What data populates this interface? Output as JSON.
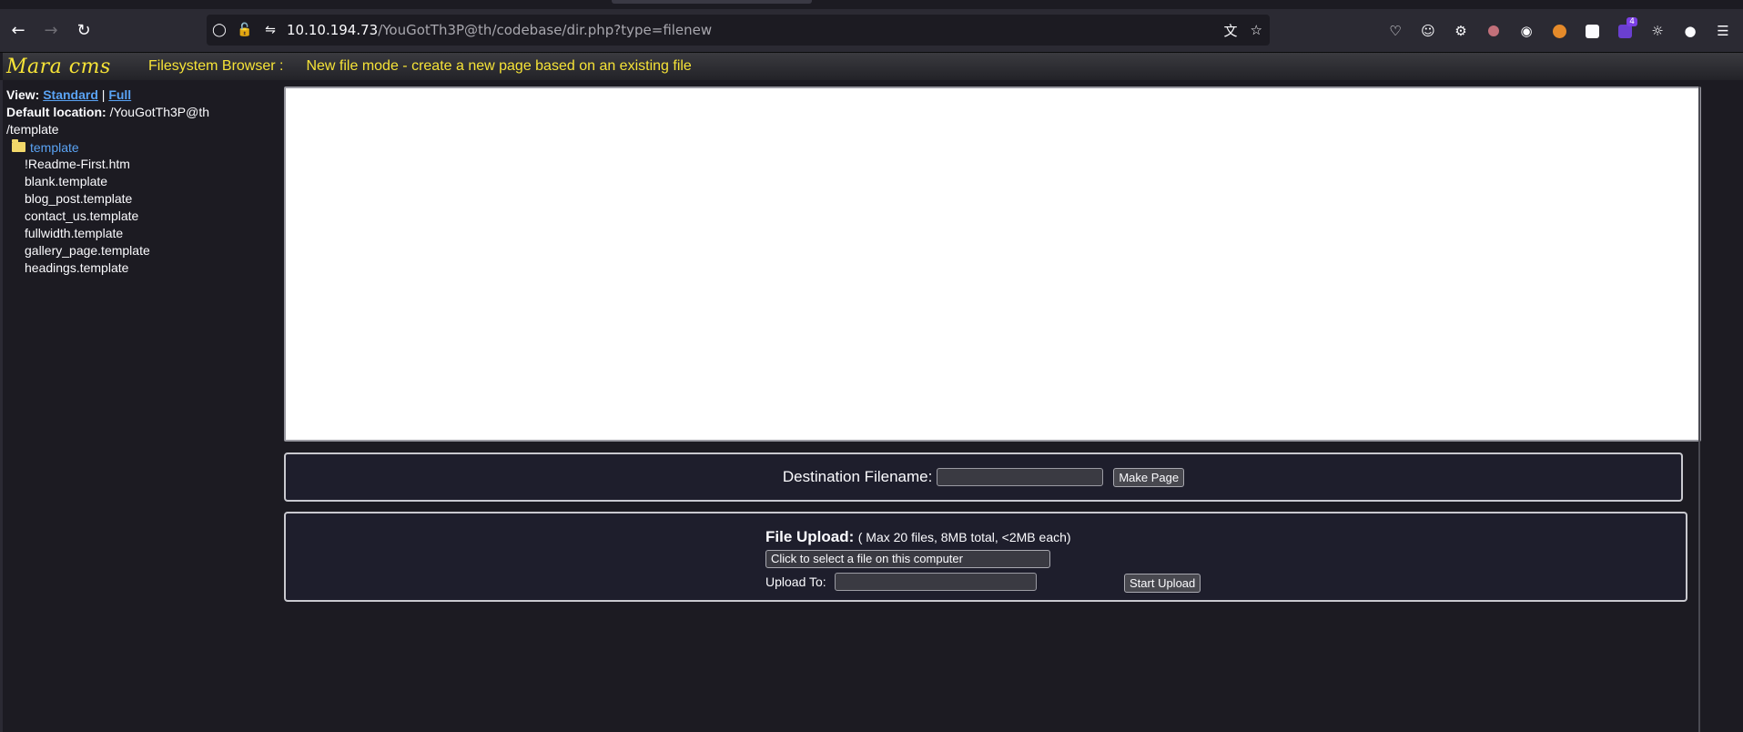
{
  "browser": {
    "url_host": "10.10.194.73",
    "url_path": "/YouGotTh3P@th/codebase/dir.php?type=filenew",
    "extension_badge": "4",
    "icons": [
      "back-icon",
      "forward-icon",
      "reload-icon",
      "shield-icon",
      "lock-icon",
      "permissions-icon",
      "translate-icon",
      "bookmark-star-icon",
      "pocket-icon",
      "account-icon",
      "extensions-icon",
      "ext-1-icon",
      "ext-2-icon",
      "ext-3-icon",
      "ext-4-icon",
      "ext-5-icon",
      "ext-6-icon",
      "ext-7-icon",
      "menu-icon"
    ]
  },
  "cms": {
    "logo": "Mara cms",
    "title": "Filesystem Browser :",
    "mode": "New file mode - create a new page based on an existing file"
  },
  "sidebar": {
    "view_label": "View:",
    "view_standard": "Standard",
    "view_separator": "|",
    "view_full": "Full",
    "default_location_label": "Default location:",
    "default_location_value": "/YouGotTh3P@th",
    "default_location_value_2": "/template",
    "folder": "template",
    "files": [
      "!Readme-First.htm",
      "blank.template",
      "blog_post.template",
      "contact_us.template",
      "fullwidth.template",
      "gallery_page.template",
      "headings.template"
    ]
  },
  "make_page": {
    "label": "Destination Filename:",
    "input_value": "",
    "button": "Make Page"
  },
  "upload": {
    "title": "File Upload:",
    "subtitle": "( Max 20 files, 8MB total, <2MB each)",
    "select_button": "Click to select a file on this computer",
    "upload_to_label": "Upload To:",
    "upload_to_value": "",
    "start_button": "Start Upload"
  },
  "colors": {
    "accent_yellow": "#f6e337",
    "link_blue": "#5aa3f4",
    "background": "#1c1b22"
  }
}
